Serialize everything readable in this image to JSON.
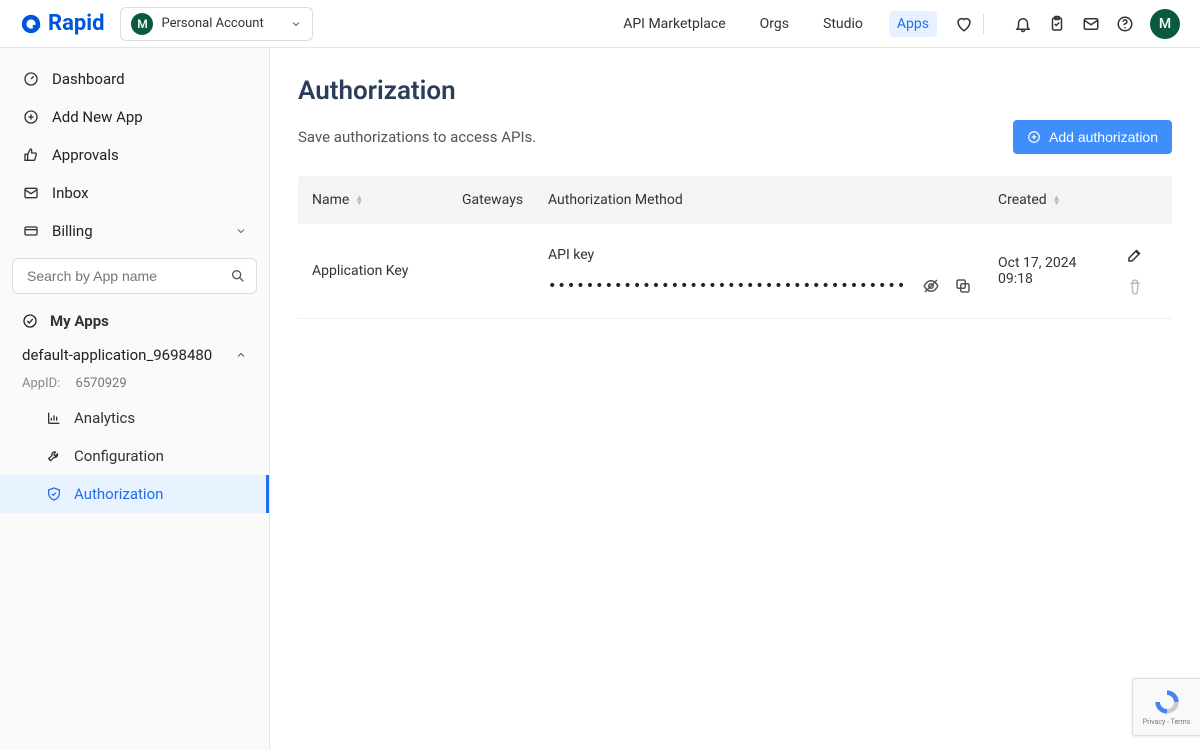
{
  "header": {
    "brand": "Rapid",
    "account_initial": "M",
    "account_label": "Personal Account",
    "nav": [
      "API Marketplace",
      "Orgs",
      "Studio",
      "Apps"
    ],
    "active_nav": "Apps",
    "user_initial": "M"
  },
  "sidebar": {
    "items": [
      {
        "icon": "gauge",
        "label": "Dashboard"
      },
      {
        "icon": "plus-circle",
        "label": "Add New App"
      },
      {
        "icon": "thumbs-up",
        "label": "Approvals"
      },
      {
        "icon": "mail",
        "label": "Inbox"
      },
      {
        "icon": "card",
        "label": "Billing",
        "chevron": true
      }
    ],
    "search_placeholder": "Search by App name",
    "section_label": "My Apps",
    "app": {
      "name": "default-application_9698480",
      "app_id_label": "AppID:",
      "app_id": "6570929",
      "subitems": [
        {
          "icon": "chart",
          "label": "Analytics"
        },
        {
          "icon": "wrench",
          "label": "Configuration"
        },
        {
          "icon": "shield",
          "label": "Authorization",
          "active": true
        }
      ]
    }
  },
  "page": {
    "title": "Authorization",
    "subtitle": "Save authorizations to access APIs.",
    "add_button": "Add authorization",
    "columns": {
      "name": "Name",
      "gateways": "Gateways",
      "method": "Authorization Method",
      "created": "Created"
    },
    "rows": [
      {
        "name": "Application Key",
        "gateways": "",
        "method_label": "API key",
        "key_masked": "••••••••••••••••••••••••••••••••••••••••••••••••••",
        "created": "Oct 17, 2024 09:18"
      }
    ]
  },
  "recaptcha": {
    "privacy": "Privacy",
    "terms": "Terms",
    "sep": " - "
  }
}
